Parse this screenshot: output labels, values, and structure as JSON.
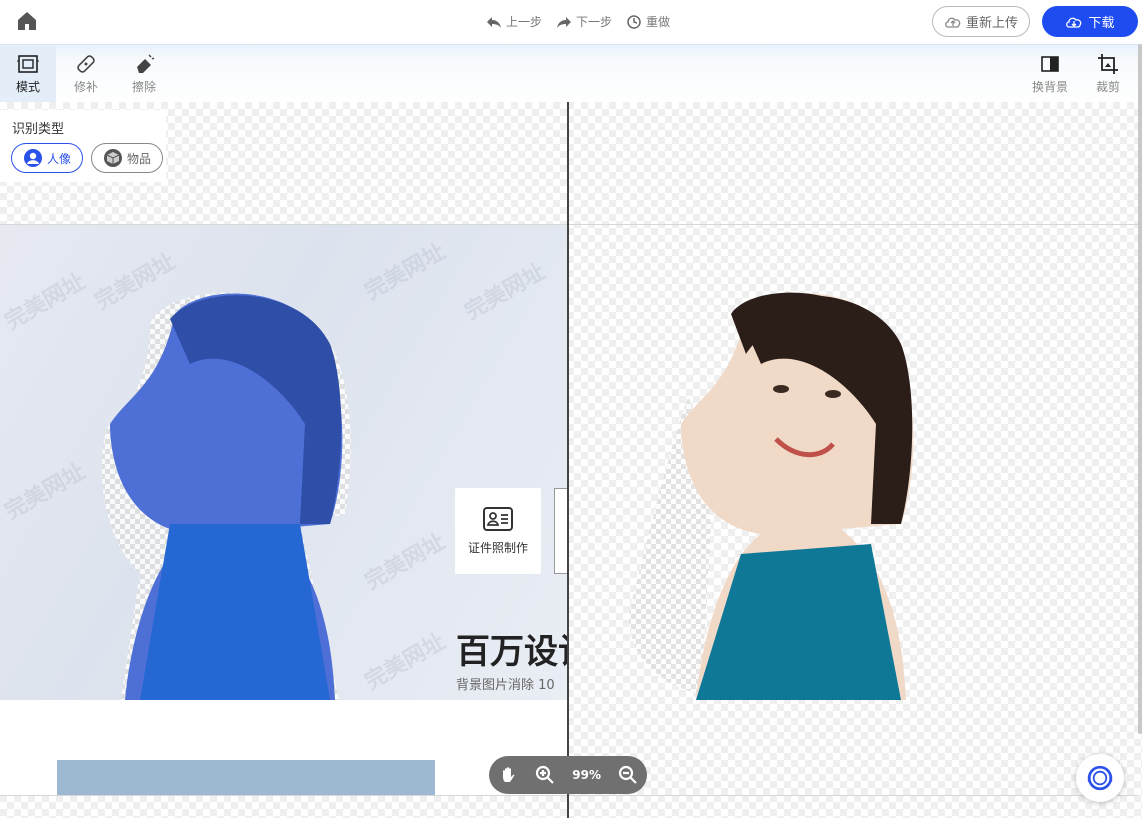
{
  "header": {
    "home_icon": "home-icon",
    "undo_label": "上一步",
    "redo_label": "下一步",
    "reset_label": "重做",
    "reupload_label": "重新上传",
    "download_label": "下载"
  },
  "toolbar": {
    "tools": [
      {
        "label": "模式",
        "icon": "mode-icon",
        "active": true
      },
      {
        "label": "修补",
        "icon": "patch-brush-icon"
      },
      {
        "label": "擦除",
        "icon": "eraser-icon"
      }
    ],
    "right_tools": [
      {
        "label": "换背景",
        "icon": "swap-background-icon"
      },
      {
        "label": "裁剪",
        "icon": "crop-icon"
      }
    ]
  },
  "recognition": {
    "title": "识别类型",
    "options": [
      {
        "label": "人像",
        "icon": "person-icon",
        "selected": true
      },
      {
        "label": "物品",
        "icon": "object-icon",
        "selected": false
      }
    ]
  },
  "canvas": {
    "watermark": "完美网址",
    "promo_title": "百万设计",
    "promo_subtitle": "背景图片消除 10",
    "promo_card_label": "证件照制作"
  },
  "zoom": {
    "value": "99%"
  },
  "colors": {
    "accent": "#1f4cf0",
    "mask_blue": "#4d6fd6",
    "dress_teal": "#0f7897"
  }
}
